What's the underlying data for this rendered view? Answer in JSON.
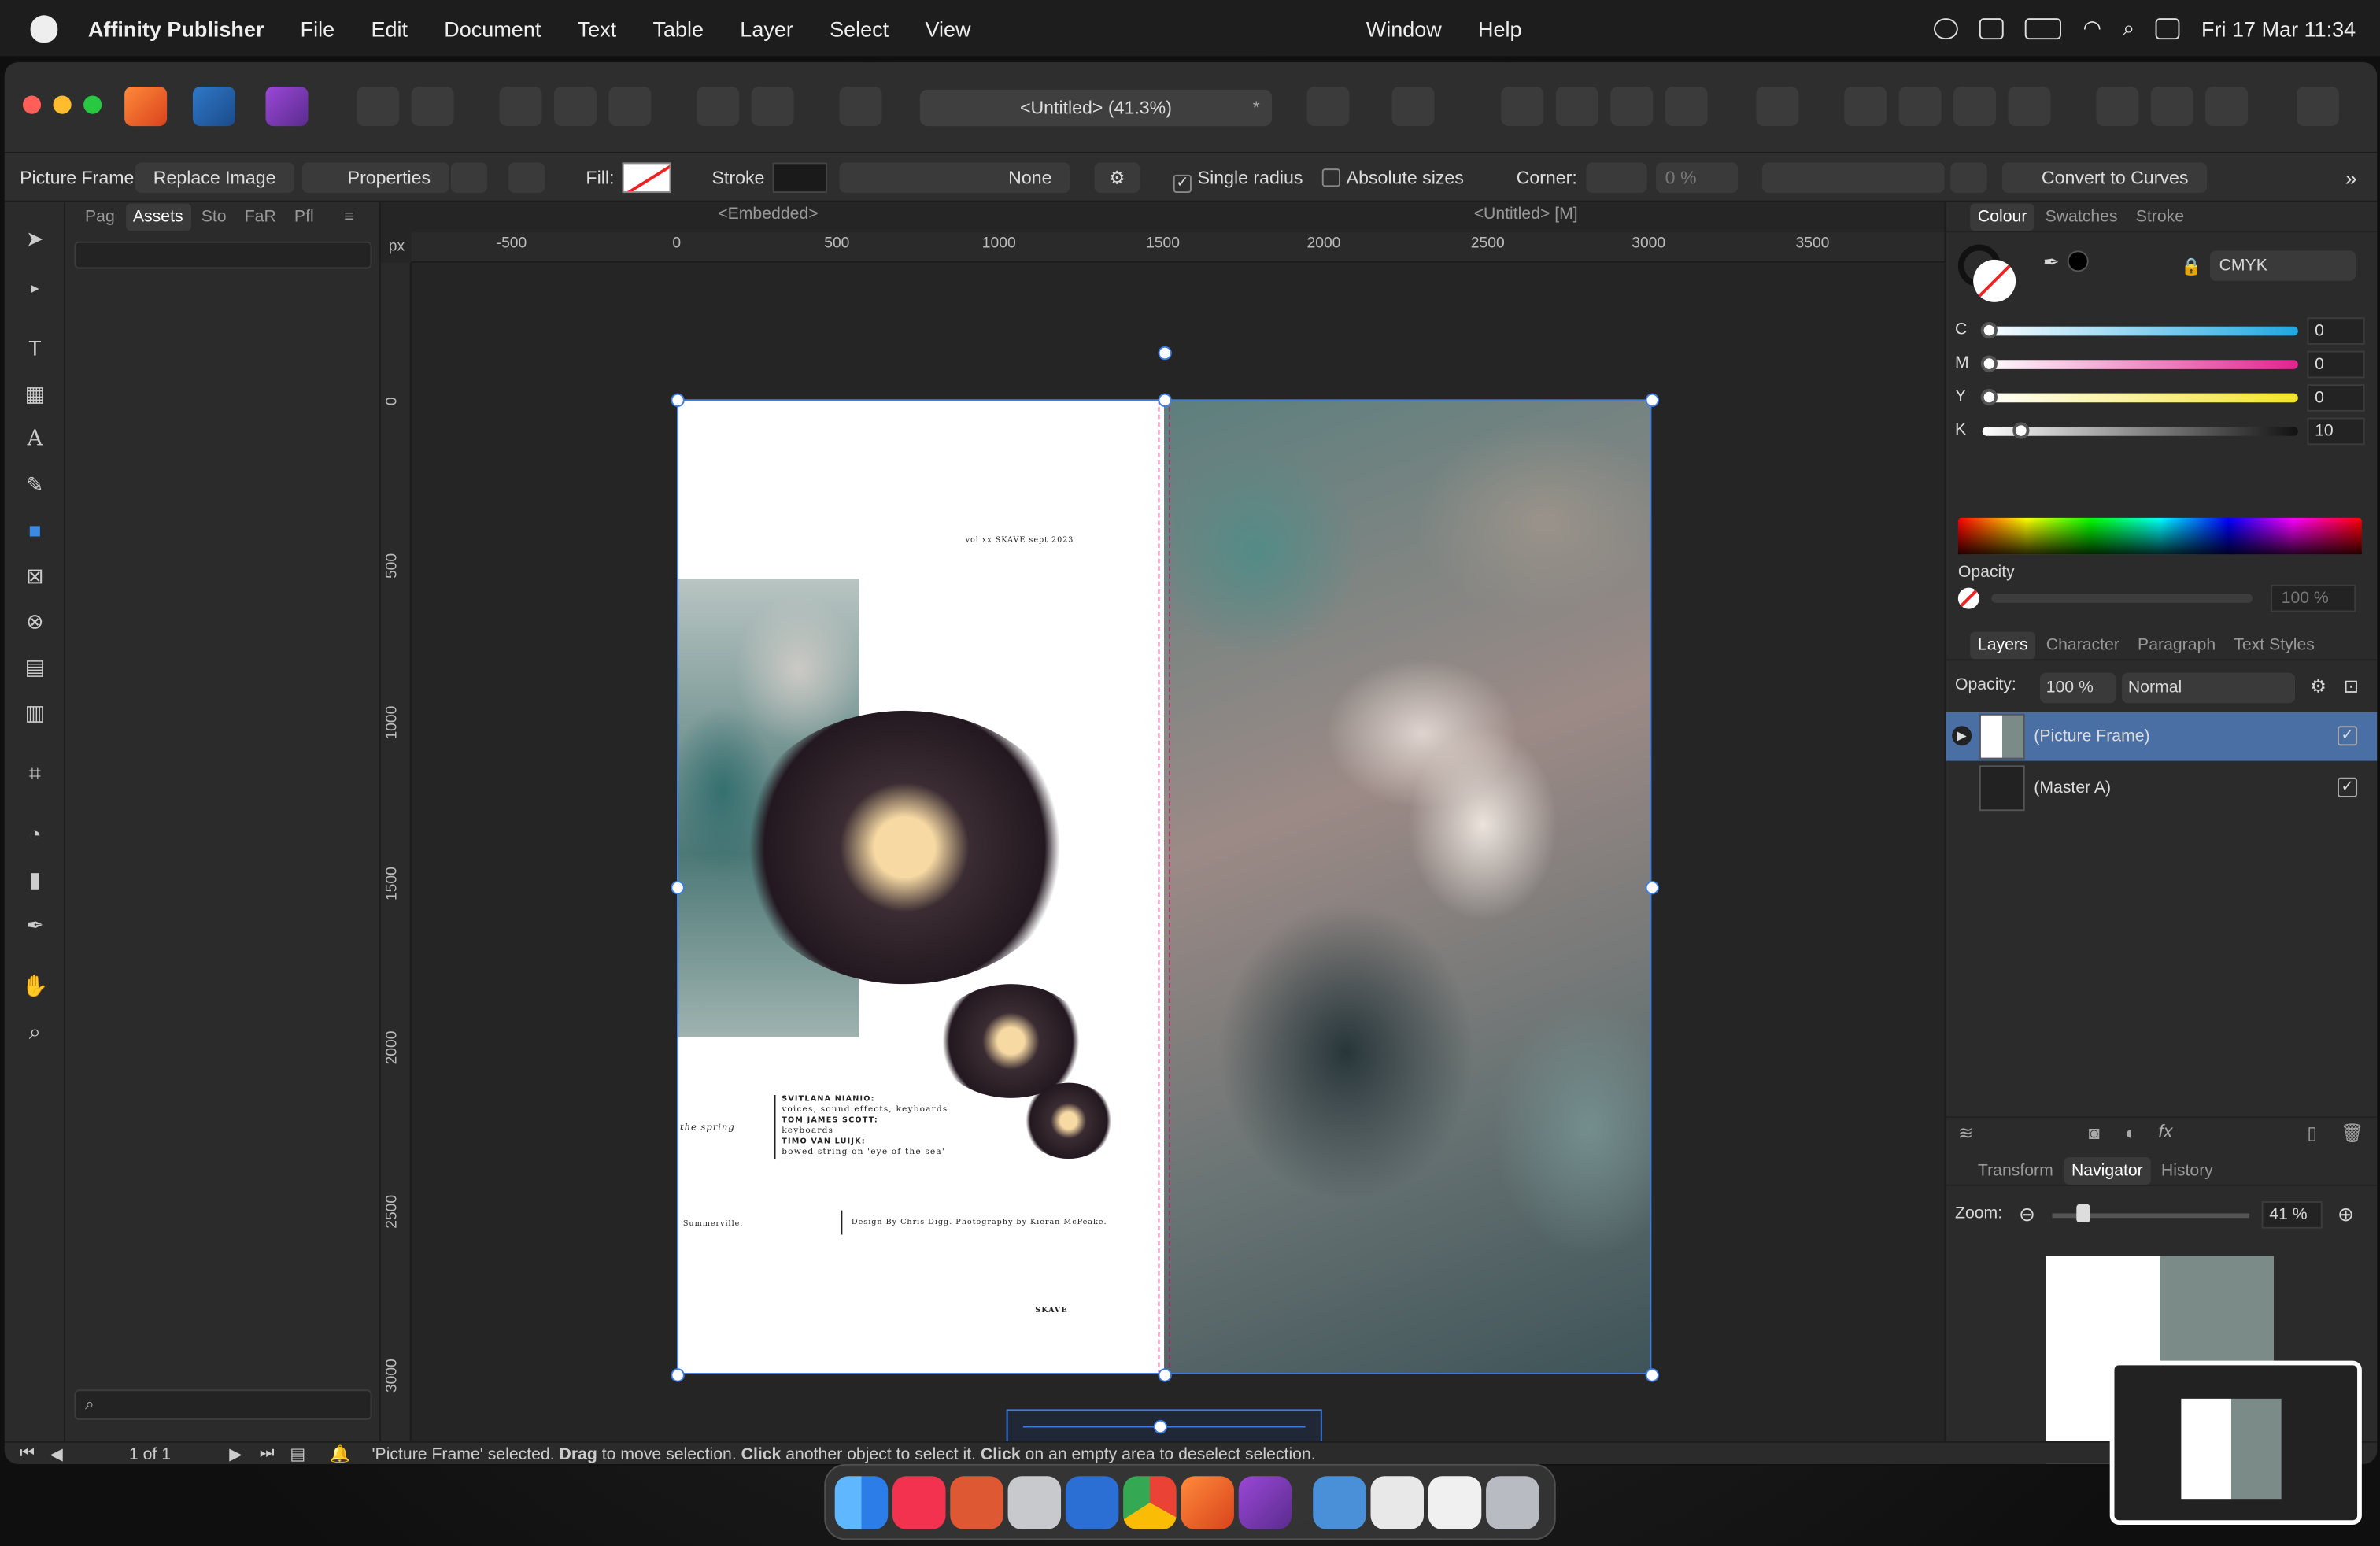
{
  "menubar": {
    "app_name": "Affinity Publisher",
    "menus": [
      "File",
      "Edit",
      "Document",
      "Text",
      "Table",
      "Layer",
      "Select",
      "View"
    ],
    "menus_center": [
      "Window",
      "Help"
    ],
    "datetime": "Fri 17 Mar  11:34"
  },
  "toolbar": {
    "document_title": "<Untitled> (41.3%)",
    "modified_mark": "*"
  },
  "context": {
    "mode": "Picture Frame",
    "replace_image": "Replace Image",
    "properties": "Properties",
    "fill_label": "Fill:",
    "stroke_label": "Stroke",
    "stroke_value": "None",
    "single_radius": "Single radius",
    "absolute_sizes": "Absolute sizes",
    "corner_label": "Corner:",
    "corner_value": "0 %",
    "convert_to_curves": "Convert to Curves"
  },
  "left_panel": {
    "tabs": [
      "Pag",
      "Assets",
      "Sto",
      "FaR",
      "Pfl"
    ],
    "active_tab": "Assets"
  },
  "canvas": {
    "embedded_label": "<Embedded>",
    "untitled_label": "<Untitled> [M]",
    "ruler_unit": "px",
    "ruler_h": [
      "-500",
      "0",
      "500",
      "1000",
      "1500",
      "2000",
      "2500",
      "3000",
      "3500"
    ],
    "ruler_v": [
      "0",
      "500",
      "1000",
      "1500",
      "2000",
      "2500",
      "3000"
    ]
  },
  "page_text": {
    "header": "vol xx  SKAVE  sept 2023",
    "left_word": "the spring",
    "credit1_name": "SVITLANA NIANIO:",
    "credit1_role": "voices, sound effects, keyboards",
    "credit2_name": "TOM JAMES SCOTT:",
    "credit2_role": "keyboards",
    "credit3_name": "TIMO VAN LUIJK:",
    "credit3_role": "bowed string on 'eye of the sea'",
    "place": "Summerville.",
    "design": "Design By Chris Digg. Photography by Kieran McPeake.",
    "footer": "SKAVE"
  },
  "colour_panel": {
    "tabs": [
      "Colour",
      "Swatches",
      "Stroke"
    ],
    "active_tab": "Colour",
    "model": "CMYK",
    "channels": [
      {
        "label": "C",
        "value": "0",
        "level": 0,
        "color": "#1fa7e0"
      },
      {
        "label": "M",
        "value": "0",
        "level": 0,
        "color": "#e0248e"
      },
      {
        "label": "Y",
        "value": "0",
        "level": 0,
        "color": "#f2e32a"
      },
      {
        "label": "K",
        "value": "10",
        "level": 10,
        "color": "#111111"
      }
    ],
    "opacity_label": "Opacity",
    "opacity_value": "100 %"
  },
  "layers_panel": {
    "tabs": [
      "Layers",
      "Character",
      "Paragraph",
      "Text Styles"
    ],
    "active_tab": "Layers",
    "opacity_label": "Opacity:",
    "opacity_value": "100 %",
    "blend_mode": "Normal",
    "layers": [
      {
        "name": "(Picture Frame)",
        "selected": true,
        "visible": "✓"
      },
      {
        "name": "(Master A)",
        "selected": false,
        "visible": "✓"
      }
    ]
  },
  "navigator_panel": {
    "tabs": [
      "Transform",
      "Navigator",
      "History"
    ],
    "active_tab": "Navigator",
    "zoom_label": "Zoom:",
    "zoom_value": "41 %"
  },
  "status": {
    "page_info": "1 of 1",
    "msg_a": "'Picture Frame' selected. ",
    "msg_b": "Drag",
    "msg_c": " to move selection. ",
    "msg_d": "Click",
    "msg_e": " another object to select it. ",
    "msg_f": "Click",
    "msg_g": " on an empty area to deselect selection."
  },
  "colors": {
    "accent": "#3d7be0",
    "selection_row": "#4a6fa5"
  }
}
